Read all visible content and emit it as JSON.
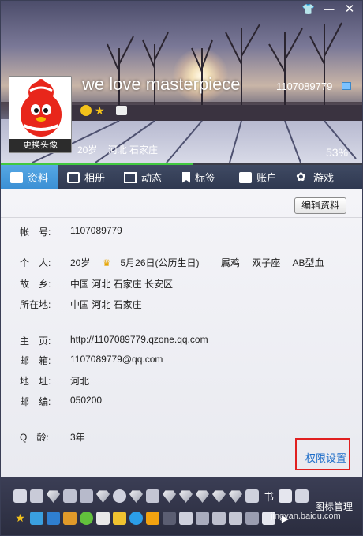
{
  "header": {
    "nickname": "we love masterpiece",
    "qq_number": "1107089779",
    "age": "20岁",
    "location": "河北 石家庄",
    "avatar_caption": "更换头像",
    "completion_percent": "53%",
    "completion_value": 53
  },
  "tabs": [
    {
      "label": "资料",
      "icon": "profile-card-icon"
    },
    {
      "label": "相册",
      "icon": "album-icon"
    },
    {
      "label": "动态",
      "icon": "feed-icon"
    },
    {
      "label": "标签",
      "icon": "bookmark-icon"
    },
    {
      "label": "账户",
      "icon": "wallet-icon"
    },
    {
      "label": "游戏",
      "icon": "game-icon"
    }
  ],
  "profile": {
    "edit_button": "编辑资料",
    "account_label": "帐　号:",
    "account_value": "1107089779",
    "personal_label": "个　人:",
    "personal_age": "20岁",
    "personal_birthday": "5月26日(公历生日)",
    "personal_zodiac": "属鸡",
    "personal_constellation": "双子座",
    "personal_blood": "AB型血",
    "hometown_label": "故　乡:",
    "hometown_value": "中国 河北 石家庄 长安区",
    "location_label": "所在地:",
    "location_value": "中国 河北 石家庄",
    "homepage_label": "主　页:",
    "homepage_value": "http://1107089779.qzone.qq.com",
    "email_label": "邮　箱:",
    "email_value": "1107089779@qq.com",
    "address_label": "地　址:",
    "address_value": "河北",
    "postcode_label": "邮　编:",
    "postcode_value": "050200",
    "qq_age_label": "Q　龄:",
    "qq_age_value": "3年",
    "permission_link": "权限设置"
  },
  "footer": {
    "manage_label": "图标管理",
    "watermark": "jingyan.baidu.com"
  },
  "colors": {
    "accent": "#3a8fd4",
    "link": "#1c6cc8",
    "highlight_box": "#e02020",
    "progress": "#41c93f"
  }
}
